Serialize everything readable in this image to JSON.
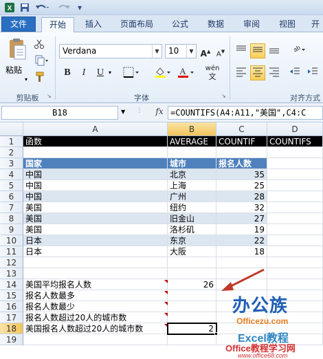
{
  "quick_access": {
    "save_icon": "save-icon",
    "undo_icon": "undo-icon",
    "redo_icon": "redo-icon"
  },
  "tabs": [
    {
      "label": "文件"
    },
    {
      "label": "开始"
    },
    {
      "label": "插入"
    },
    {
      "label": "页面布局"
    },
    {
      "label": "公式"
    },
    {
      "label": "数据"
    },
    {
      "label": "审阅"
    },
    {
      "label": "视图"
    },
    {
      "label": "开"
    }
  ],
  "ribbon": {
    "paste_label": "粘贴",
    "font_name": "Verdana",
    "font_size": "10",
    "groups": {
      "clipboard": "剪贴板",
      "font": "字体",
      "alignment": "对齐方式"
    },
    "bold": "B",
    "italic": "I",
    "underline": "U",
    "wen": "wén"
  },
  "formula_bar": {
    "cell_ref": "B18",
    "fx": "fx",
    "formula": "=COUNTIFS(A4:A11,\"美国\",C4:C"
  },
  "columns": [
    "A",
    "B",
    "C",
    "D"
  ],
  "rows": [
    "1",
    "2",
    "3",
    "4",
    "5",
    "6",
    "7",
    "8",
    "9",
    "10",
    "11",
    "12",
    "13",
    "14",
    "15",
    "16",
    "17",
    "18",
    "19"
  ],
  "sheet": {
    "row1": [
      "函数",
      "AVERAGE",
      "COUNTIF",
      "COUNTIFS"
    ],
    "header": [
      "国家",
      "城市",
      "报名人数"
    ],
    "data": [
      [
        "中国",
        "北京",
        "35"
      ],
      [
        "中国",
        "上海",
        "25"
      ],
      [
        "中国",
        "广州",
        "28"
      ],
      [
        "美国",
        "纽约",
        "32"
      ],
      [
        "美国",
        "旧金山",
        "27"
      ],
      [
        "美国",
        "洛杉矶",
        "19"
      ],
      [
        "日本",
        "东京",
        "22"
      ],
      [
        "日本",
        "大阪",
        "18"
      ]
    ],
    "questions": [
      {
        "label": "美国平均报名人数",
        "value": "26"
      },
      {
        "label": "报名人数最多",
        "value": ""
      },
      {
        "label": "报名人数最少",
        "value": ""
      },
      {
        "label": "报名人数超过20人的城市数",
        "value": ""
      },
      {
        "label": "美国报名人数超过20人的城市数",
        "value": "2"
      }
    ]
  },
  "watermark": {
    "brand": "办公族",
    "site": "Officezu.com",
    "course": "Excel教程",
    "site2": "Office教程学习网",
    "url": "www.office68.com"
  },
  "colors": {
    "accent": "#4f81bd",
    "band": "#dce6f1",
    "file_tab": "#2a6fc1",
    "arrow": "#c0392b"
  }
}
